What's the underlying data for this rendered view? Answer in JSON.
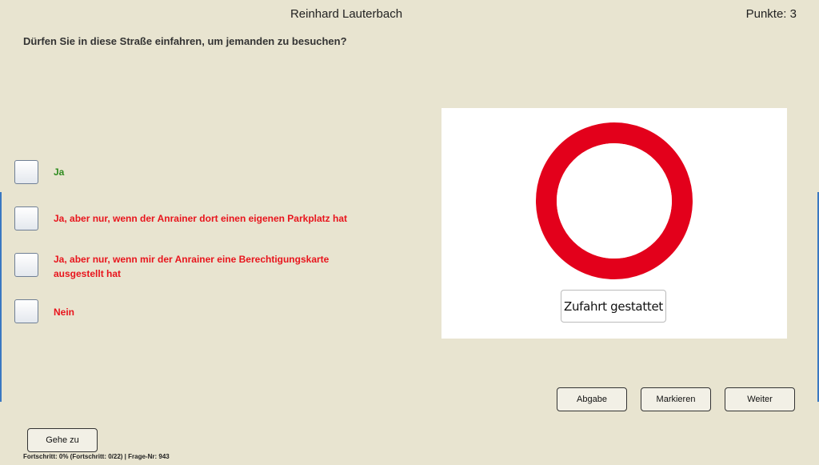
{
  "header": {
    "user_name": "Reinhard Lauterbach",
    "points": "Punkte: 3"
  },
  "question": {
    "text": "Dürfen Sie in diese Straße einfahren, um jemanden zu besuchen?"
  },
  "answers": [
    {
      "text": "Ja",
      "color": "#2e8b1e"
    },
    {
      "text": "Ja, aber nur, wenn der Anrainer dort einen eigenen Parkplatz hat",
      "color": "#e8141c"
    },
    {
      "text": "Ja, aber nur, wenn mir der Anrainer eine Berechtigungskarte ausgestellt hat",
      "color": "#e8141c"
    },
    {
      "text": "Nein",
      "color": "#e8141c"
    }
  ],
  "sign": {
    "icon": "no-vehicles-sign-icon",
    "ring_color": "#e3001b",
    "plate_text": "Zufahrt gestattet"
  },
  "buttons": {
    "submit": "Abgabe",
    "mark": "Markieren",
    "next": "Weiter",
    "goto": "Gehe zu"
  },
  "footer": {
    "progress": "Fortschritt: 0% (Fortschritt: 0/22) | Frage-Nr: 943"
  }
}
